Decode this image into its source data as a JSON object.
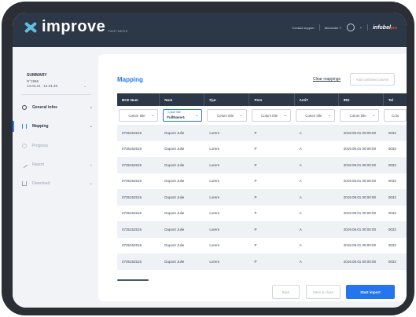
{
  "header": {
    "logo_word": "improve",
    "logo_sub": "PARTNERS",
    "contact": "Contact support",
    "user": "Alexander T.",
    "partner_logo": "infobel",
    "partner_logo_suffix": "pro",
    "colors": {
      "bar": "#2c3747",
      "accent": "#5fc0de"
    }
  },
  "sidebar": {
    "summary_title": "SUMMARY",
    "summary_no": "N°1966",
    "summary_date": "14.01.21 - 14:31:26",
    "items": [
      {
        "label": "General infos",
        "icon": "gear-icon",
        "state": "done"
      },
      {
        "label": "Mapping",
        "icon": "columns-icon",
        "state": "active"
      },
      {
        "label": "Progress",
        "icon": "progress-icon",
        "state": "disabled"
      },
      {
        "label": "Report",
        "icon": "report-icon",
        "state": "disabled"
      },
      {
        "label": "Download",
        "icon": "download-icon",
        "state": "disabled"
      }
    ]
  },
  "main": {
    "title": "Mapping",
    "clear_link": "Clear mappings",
    "add_column": "Add combined column",
    "columns": [
      "BCE Num",
      "Nom",
      "Fjur",
      "Pers",
      "ActiT",
      "IRD",
      "Tel"
    ],
    "selects": [
      {
        "value": "Colum title",
        "active": false
      },
      {
        "value": "FullName1",
        "caption": "Colum title",
        "active": true
      },
      {
        "value": "Colum title",
        "active": false
      },
      {
        "value": "Colum title",
        "active": false
      },
      {
        "value": "Colum title",
        "active": false
      },
      {
        "value": "Colum title",
        "active": false
      },
      {
        "value": "Colu",
        "active": false
      }
    ],
    "rows": [
      [
        "0735152515",
        "Dupont Julie",
        "Lorem",
        "P",
        "A",
        "2019.09.01 00:00:00",
        "0032"
      ],
      [
        "0735152515",
        "Dupont Julie",
        "Lorem",
        "P",
        "A",
        "2019.09.01 00:00:00",
        "0032"
      ],
      [
        "0735152515",
        "Dupont Julie",
        "Lorem",
        "P",
        "A",
        "2019.09.01 00:00:00",
        "0032"
      ],
      [
        "0735152515",
        "Dupont Julie",
        "Lorem",
        "P",
        "A",
        "2019.09.01 00:00:00",
        "0032"
      ],
      [
        "0735152515",
        "Dupont Julie",
        "Lorem",
        "P",
        "A",
        "2019.09.01 00:00:00",
        "0032"
      ],
      [
        "0735152515",
        "Dupont Julie",
        "Lorem",
        "P",
        "A",
        "2019.09.01 00:00:00",
        "0032"
      ],
      [
        "0735152515",
        "Dupont Julie",
        "Lorem",
        "P",
        "A",
        "2019.09.01 00:00:00",
        "0032"
      ],
      [
        "0735152515",
        "Dupont Julie",
        "Lorem",
        "P",
        "A",
        "2019.09.01 00:00:00",
        "0032"
      ],
      [
        "0735152515",
        "Dupont Julie",
        "Lorem",
        "P",
        "A",
        "2019.09.01 00:00:00",
        "0032"
      ]
    ],
    "buttons": {
      "back": "Back",
      "save_close": "Save & close",
      "start": "Start import"
    },
    "colors": {
      "primary": "#2576ee"
    }
  }
}
